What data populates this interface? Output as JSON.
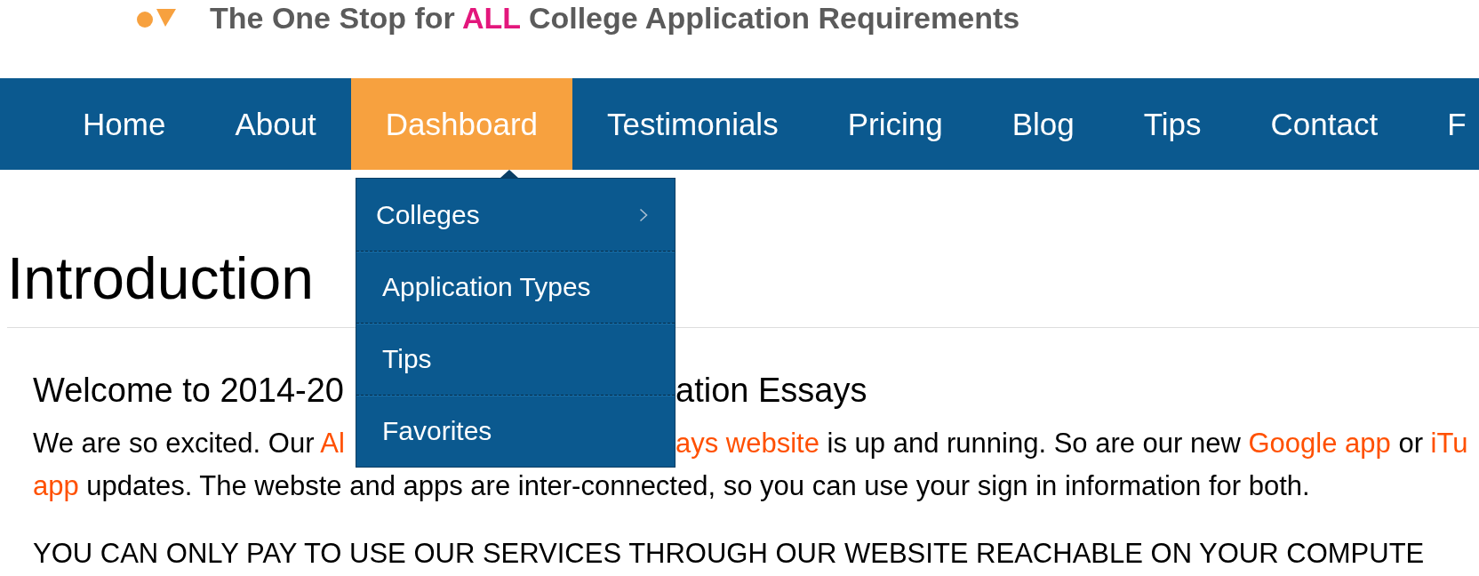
{
  "header": {
    "tagline_parts": [
      {
        "text": "The One Stop for ",
        "kind": "text"
      },
      {
        "text": "ALL",
        "kind": "highlight"
      },
      {
        "text": " College Application Requirements",
        "kind": "text"
      }
    ]
  },
  "nav": {
    "items": [
      {
        "label": "Home",
        "selected": false
      },
      {
        "label": "About",
        "selected": false
      },
      {
        "label": "Dashboard",
        "selected": true
      },
      {
        "label": "Testimonials",
        "selected": false
      },
      {
        "label": "Pricing",
        "selected": false
      },
      {
        "label": "Blog",
        "selected": false
      },
      {
        "label": "Tips",
        "selected": false
      },
      {
        "label": "Contact",
        "selected": false
      },
      {
        "label": "F",
        "selected": false
      }
    ]
  },
  "dropdown": {
    "items": [
      {
        "label": "Colleges",
        "has_submenu": true
      },
      {
        "label": "Application Types",
        "has_submenu": false
      },
      {
        "label": "Tips",
        "has_submenu": false
      },
      {
        "label": "Favorites",
        "has_submenu": false
      }
    ]
  },
  "content": {
    "title": "Introduction",
    "subheading": {
      "before_menu": "Welcome to 2014-20",
      "after_menu": "ation Essays"
    },
    "paragraph": {
      "line_1_before_menu": [
        {
          "text": "We are so excited. Our ",
          "kind": "text"
        },
        {
          "text": "Al",
          "kind": "link"
        }
      ],
      "line_1_after_menu": [
        {
          "text": "ays website",
          "kind": "link"
        },
        {
          "text": " is up and running. So are our new ",
          "kind": "text"
        },
        {
          "text": "Google app",
          "kind": "link"
        },
        {
          "text": " or ",
          "kind": "text"
        },
        {
          "text": "iTu",
          "kind": "link"
        }
      ],
      "line_2": [
        {
          "text": "app",
          "kind": "link"
        },
        {
          "text": " updates. The webste and apps are inter-connected, so you can use your sign in information for both.",
          "kind": "text"
        }
      ]
    },
    "notice": "YOU CAN ONLY PAY TO USE OUR SERVICES THROUGH OUR WEBSITE REACHABLE ON YOUR COMPUTE"
  }
}
